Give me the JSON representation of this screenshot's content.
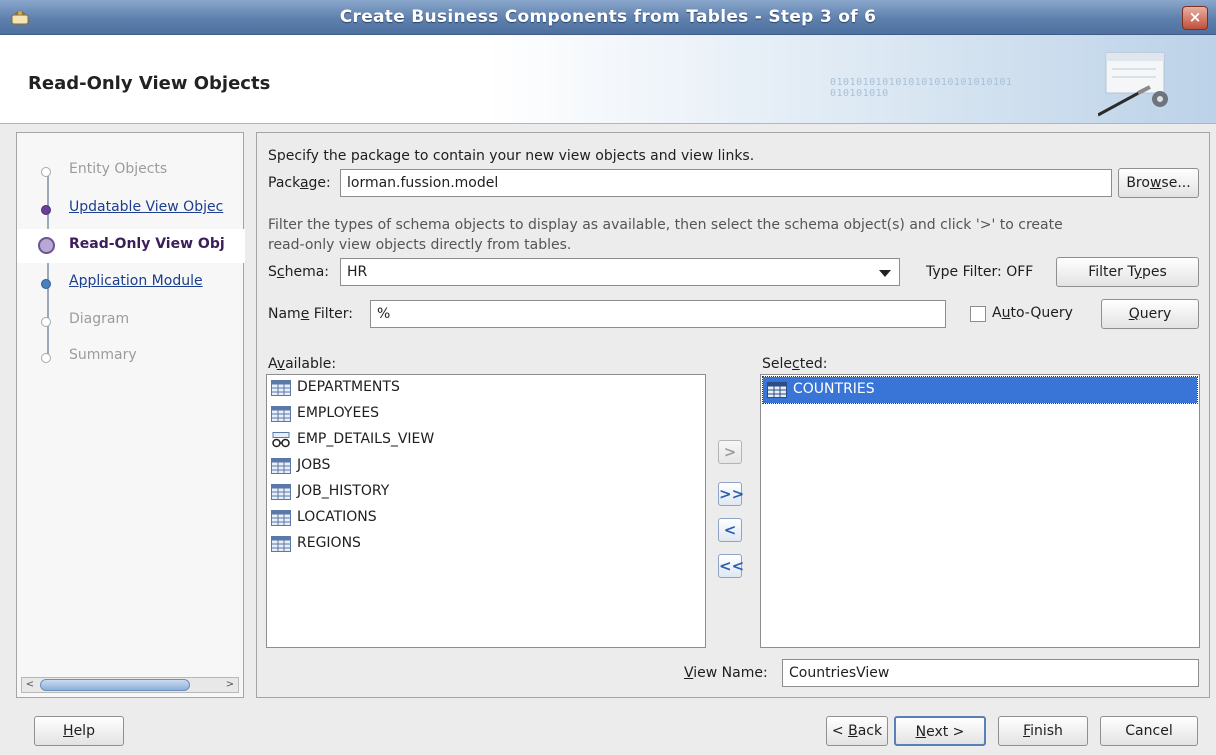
{
  "window": {
    "title": "Create Business Components from Tables - Step 3 of 6",
    "close_glyph": "×"
  },
  "header": {
    "title": "Read-Only View Objects",
    "binary_art": "0101010101010101010101010101\n010101010"
  },
  "nav": {
    "items": [
      {
        "label": "Entity Objects",
        "state": "disabled"
      },
      {
        "label": "Updatable View Objec",
        "state": "done"
      },
      {
        "label": "Read-Only View Obj",
        "state": "current"
      },
      {
        "label": "Application Module",
        "state": "link"
      },
      {
        "label": "Diagram",
        "state": "disabled"
      },
      {
        "label": "Summary",
        "state": "disabled"
      }
    ],
    "scroll_left": "<",
    "scroll_right": ">"
  },
  "form": {
    "package_intro": "Specify the package to contain your new view objects and view links.",
    "package_label_pre": "Pack",
    "package_label_mn": "a",
    "package_label_post": "ge:",
    "package_value": "lorman.fussion.model",
    "browse_pre": "Bro",
    "browse_mn": "w",
    "browse_post": "se...",
    "filter_intro_1": "Filter the types of schema objects to display as available, then select the schema object(s) and click '>' to create",
    "filter_intro_2": "read-only view objects directly from tables.",
    "schema_label_pre": "S",
    "schema_label_mn": "c",
    "schema_label_post": "hema:",
    "schema_value": "HR",
    "type_filter_status": "Type Filter: OFF",
    "filter_types_pre": "Filter T",
    "filter_types_mn": "y",
    "filter_types_post": "pes",
    "name_filter_pre": "Nam",
    "name_filter_mn": "e",
    "name_filter_post": " Filter:",
    "name_filter_value": "%",
    "auto_query_pre": "A",
    "auto_query_mn": "u",
    "auto_query_post": "to-Query",
    "query_mn": "Q",
    "query_post": "uery",
    "available_pre": "A",
    "available_mn": "v",
    "available_post": "ailable:",
    "selected_pre": "Sele",
    "selected_mn": "c",
    "selected_post": "ted:",
    "available_items": [
      {
        "label": "DEPARTMENTS",
        "icon": "table-icon"
      },
      {
        "label": "EMPLOYEES",
        "icon": "table-icon"
      },
      {
        "label": "EMP_DETAILS_VIEW",
        "icon": "view-icon"
      },
      {
        "label": "JOBS",
        "icon": "table-icon"
      },
      {
        "label": "JOB_HISTORY",
        "icon": "table-icon"
      },
      {
        "label": "LOCATIONS",
        "icon": "table-icon"
      },
      {
        "label": "REGIONS",
        "icon": "table-icon"
      }
    ],
    "selected_items": [
      {
        "label": "COUNTRIES",
        "icon": "table-icon"
      }
    ],
    "shuttle": {
      "add": ">",
      "add_all": ">>",
      "remove": "<",
      "remove_all": "<<"
    },
    "view_name_mn": "V",
    "view_name_post": "iew Name:",
    "view_name_value": "CountriesView"
  },
  "footer": {
    "help_mn": "H",
    "help_post": "elp",
    "back_pre": "< ",
    "back_mn": "B",
    "back_post": "ack",
    "next_mn": "N",
    "next_post": "ext >",
    "finish_mn": "F",
    "finish_post": "inish",
    "cancel": "Cancel"
  },
  "colors": {
    "selection": "#3875d7",
    "title_bar": "#5e80ad",
    "link": "#1c3e8f",
    "current_step": "#3b1e5a"
  }
}
